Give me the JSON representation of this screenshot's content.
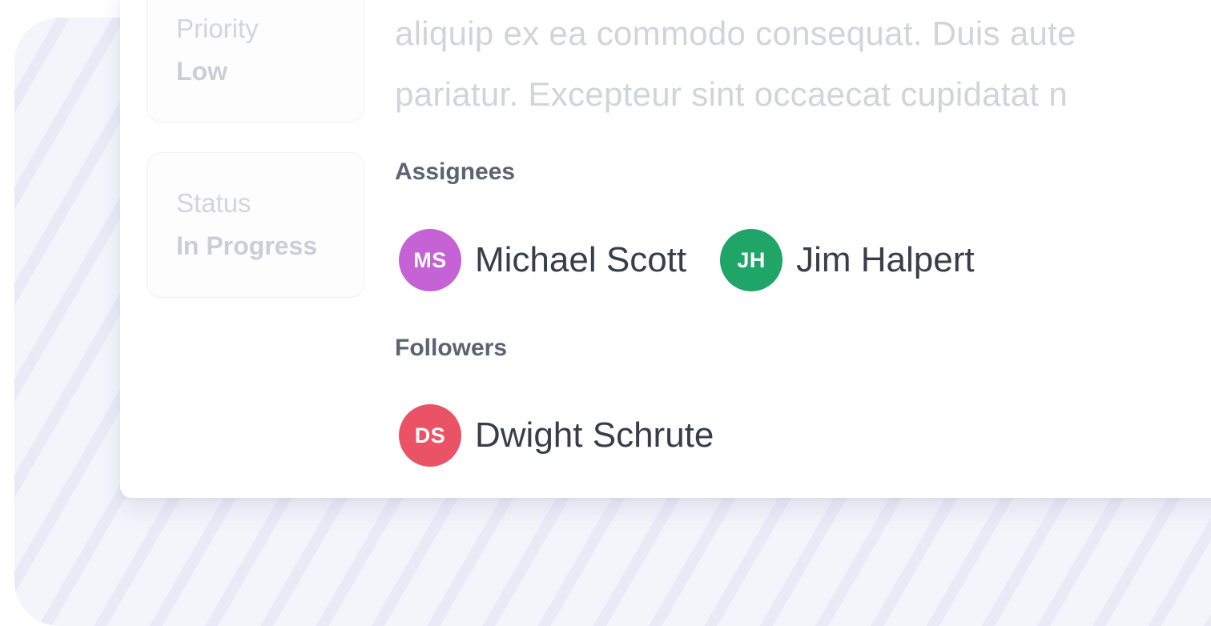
{
  "details": {
    "priority": {
      "label": "Priority",
      "value": "Low"
    },
    "status": {
      "label": "Status",
      "value": "In Progress"
    }
  },
  "description": {
    "line1": "aliquip ex ea commodo consequat. Duis aute",
    "line2": "pariatur. Excepteur sint occaecat cupidatat n"
  },
  "assignees": {
    "heading": "Assignees",
    "people": [
      {
        "initials": "MS",
        "name": "Michael Scott",
        "color": "#c562d6"
      },
      {
        "initials": "JH",
        "name": "Jim Halpert",
        "color": "#1fa568"
      }
    ]
  },
  "followers": {
    "heading": "Followers",
    "people": [
      {
        "initials": "DS",
        "name": "Dwight Schrute",
        "color": "#ea5366"
      }
    ]
  }
}
